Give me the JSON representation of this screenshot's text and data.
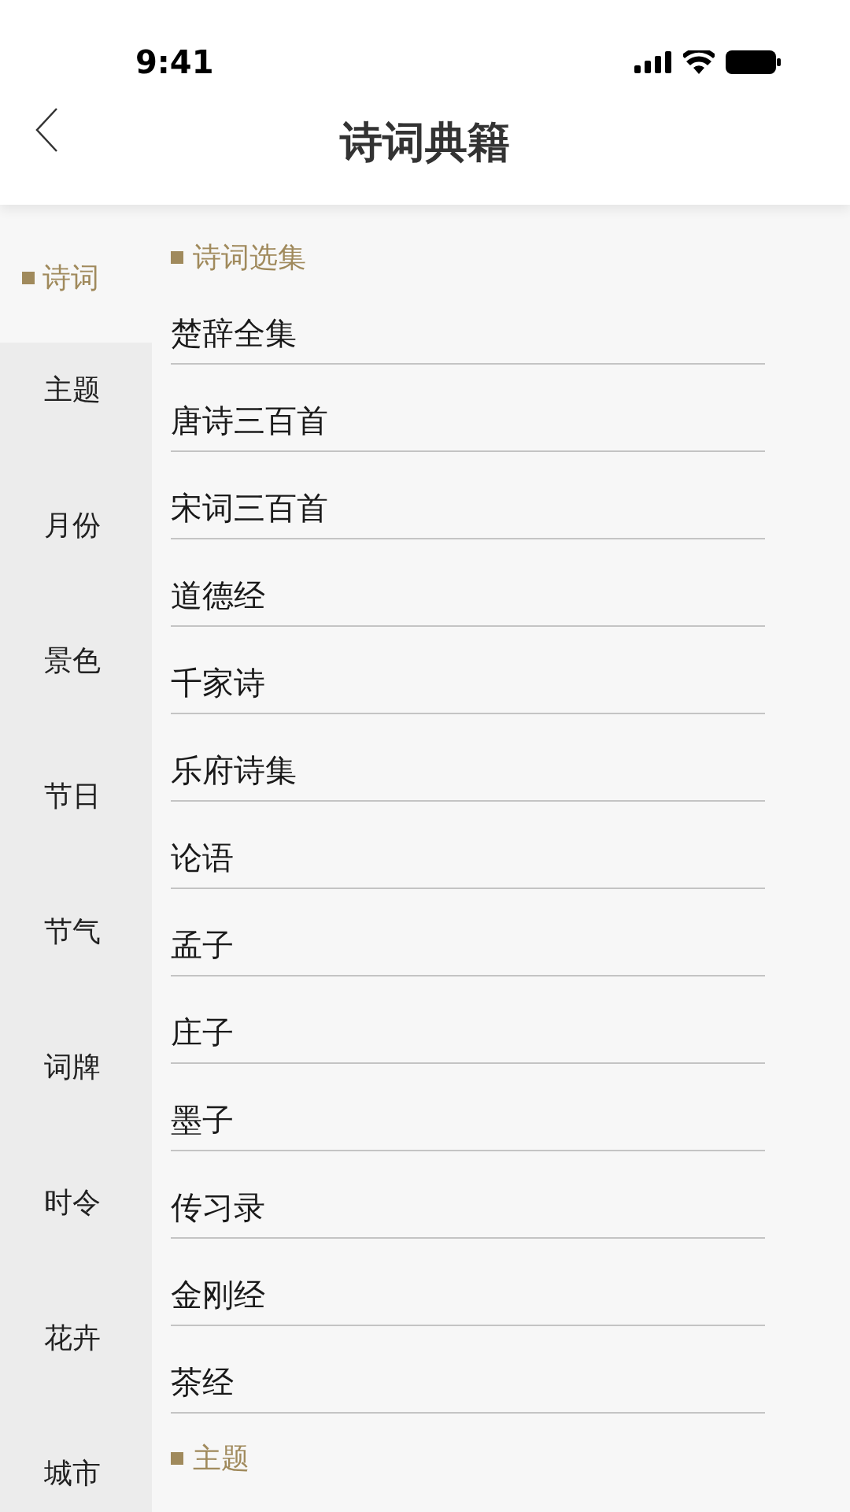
{
  "status_bar": {
    "time": "9:41"
  },
  "header": {
    "title": "诗词典籍"
  },
  "sidebar": {
    "items": [
      {
        "label": "诗词",
        "selected": true
      },
      {
        "label": "主题",
        "selected": false
      },
      {
        "label": "月份",
        "selected": false
      },
      {
        "label": "景色",
        "selected": false
      },
      {
        "label": "节日",
        "selected": false
      },
      {
        "label": "节气",
        "selected": false
      },
      {
        "label": "词牌",
        "selected": false
      },
      {
        "label": "时令",
        "selected": false
      },
      {
        "label": "花卉",
        "selected": false
      },
      {
        "label": "城市",
        "selected": false
      }
    ]
  },
  "sections": [
    {
      "title": "诗词选集",
      "items": [
        "楚辞全集",
        "唐诗三百首",
        "宋词三百首",
        "道德经",
        "千家诗",
        "乐府诗集",
        "论语",
        "孟子",
        "庄子",
        "墨子",
        "传习录",
        "金刚经",
        "茶经"
      ]
    },
    {
      "title": "主题"
    }
  ]
}
